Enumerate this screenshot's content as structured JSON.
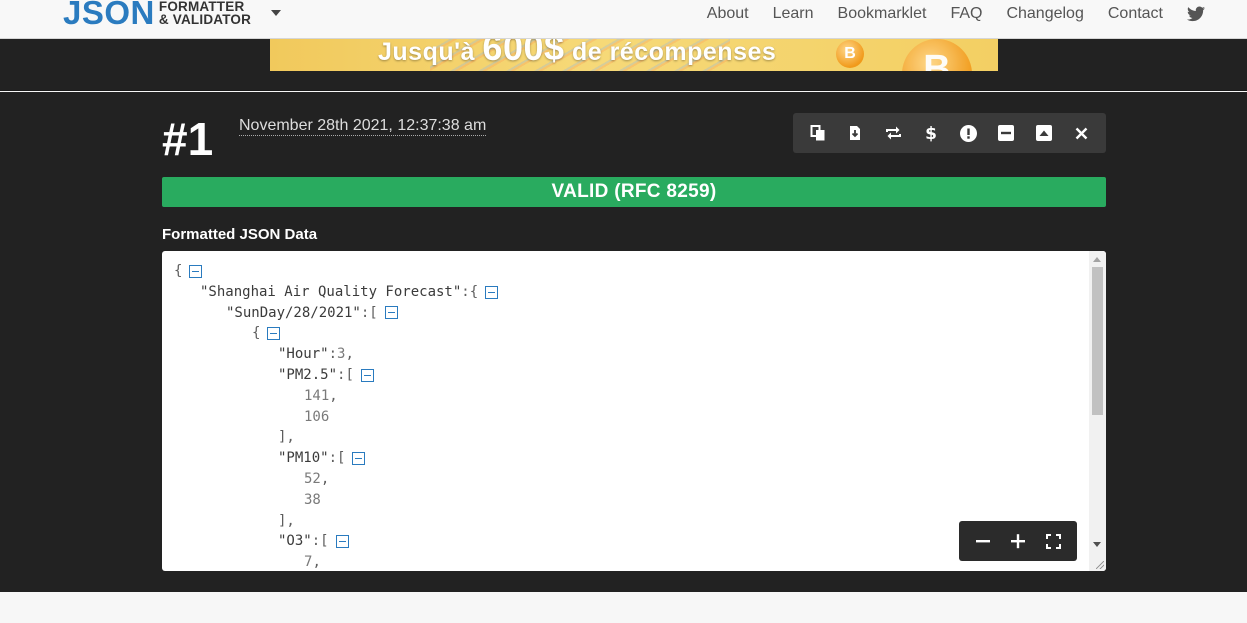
{
  "header": {
    "logo_main": "JSON",
    "logo_line1": "FORMATTER",
    "logo_line2": "& VALIDATOR",
    "nav": [
      "About",
      "Learn",
      "Bookmarklet",
      "FAQ",
      "Changelog",
      "Contact"
    ],
    "twitter_icon": "twitter-icon"
  },
  "ad": {
    "text_before": "Jusqu'à ",
    "text_amount": "600$",
    "text_after": " de récompenses",
    "coin_symbol": "B"
  },
  "result": {
    "number": "#1",
    "timestamp": "November 28th 2021, 12:37:38 am",
    "toolbar_icons": [
      "copy-icon",
      "download-icon",
      "repeat-icon",
      "dollar-icon",
      "exclamation-icon",
      "collapse-icon",
      "expand-icon",
      "close-icon"
    ],
    "status": "VALID (RFC 8259)",
    "status_color": "#29ab5f",
    "section_label": "Formatted JSON Data"
  },
  "code_lines": [
    {
      "indent": 0,
      "parts": [
        [
          "p",
          "{"
        ]
      ],
      "toggle": true
    },
    {
      "indent": 1,
      "parts": [
        [
          "k",
          "\"Shanghai Air Quality Forecast\""
        ],
        [
          "p",
          ":{"
        ]
      ],
      "toggle": true
    },
    {
      "indent": 2,
      "parts": [
        [
          "k",
          "\"SunDay/28/2021\""
        ],
        [
          "p",
          ":["
        ]
      ],
      "toggle": true
    },
    {
      "indent": 3,
      "parts": [
        [
          "p",
          "{"
        ]
      ],
      "toggle": true
    },
    {
      "indent": 4,
      "parts": [
        [
          "k",
          "\"Hour\""
        ],
        [
          "p",
          ":"
        ],
        [
          "n",
          "3"
        ],
        [
          "p",
          ","
        ]
      ],
      "toggle": false
    },
    {
      "indent": 4,
      "parts": [
        [
          "k",
          "\"PM2.5\""
        ],
        [
          "p",
          ":["
        ]
      ],
      "toggle": true
    },
    {
      "indent": 5,
      "parts": [
        [
          "n",
          "141"
        ],
        [
          "p",
          ","
        ]
      ],
      "toggle": false
    },
    {
      "indent": 5,
      "parts": [
        [
          "n",
          "106"
        ]
      ],
      "toggle": false
    },
    {
      "indent": 4,
      "parts": [
        [
          "p",
          "],"
        ]
      ],
      "toggle": false
    },
    {
      "indent": 4,
      "parts": [
        [
          "k",
          "\"PM10\""
        ],
        [
          "p",
          ":["
        ]
      ],
      "toggle": true
    },
    {
      "indent": 5,
      "parts": [
        [
          "n",
          "52"
        ],
        [
          "p",
          ","
        ]
      ],
      "toggle": false
    },
    {
      "indent": 5,
      "parts": [
        [
          "n",
          "38"
        ]
      ],
      "toggle": false
    },
    {
      "indent": 4,
      "parts": [
        [
          "p",
          "],"
        ]
      ],
      "toggle": false
    },
    {
      "indent": 4,
      "parts": [
        [
          "k",
          "\"O3\""
        ],
        [
          "p",
          ":["
        ]
      ],
      "toggle": true
    },
    {
      "indent": 5,
      "parts": [
        [
          "n",
          "7"
        ],
        [
          "p",
          ","
        ]
      ],
      "toggle": false
    }
  ],
  "zoom_icons": [
    "zoom-out-icon",
    "zoom-in-icon",
    "fullscreen-icon"
  ],
  "colors": {
    "accent": "#2a7bbf",
    "dark_bg": "#222222",
    "valid": "#29ab5f"
  }
}
